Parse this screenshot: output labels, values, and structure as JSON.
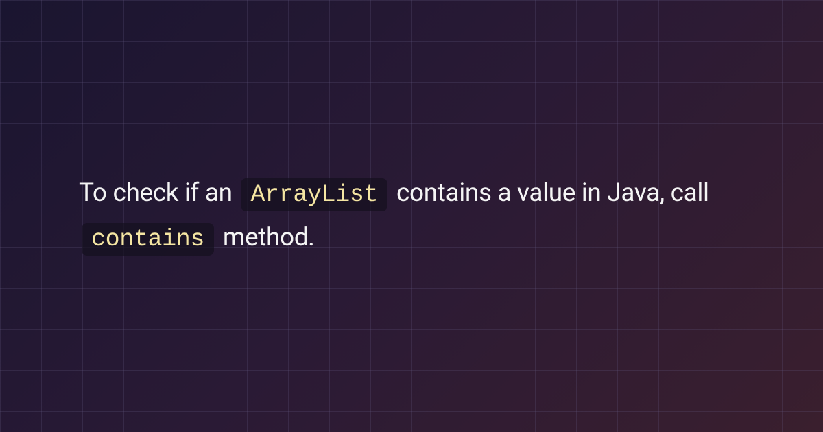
{
  "content": {
    "text_part_1": "To check if an ",
    "code_1": "ArrayList",
    "text_part_2": " contains a value in Java, call ",
    "code_2": "contains",
    "text_part_3": " method."
  }
}
